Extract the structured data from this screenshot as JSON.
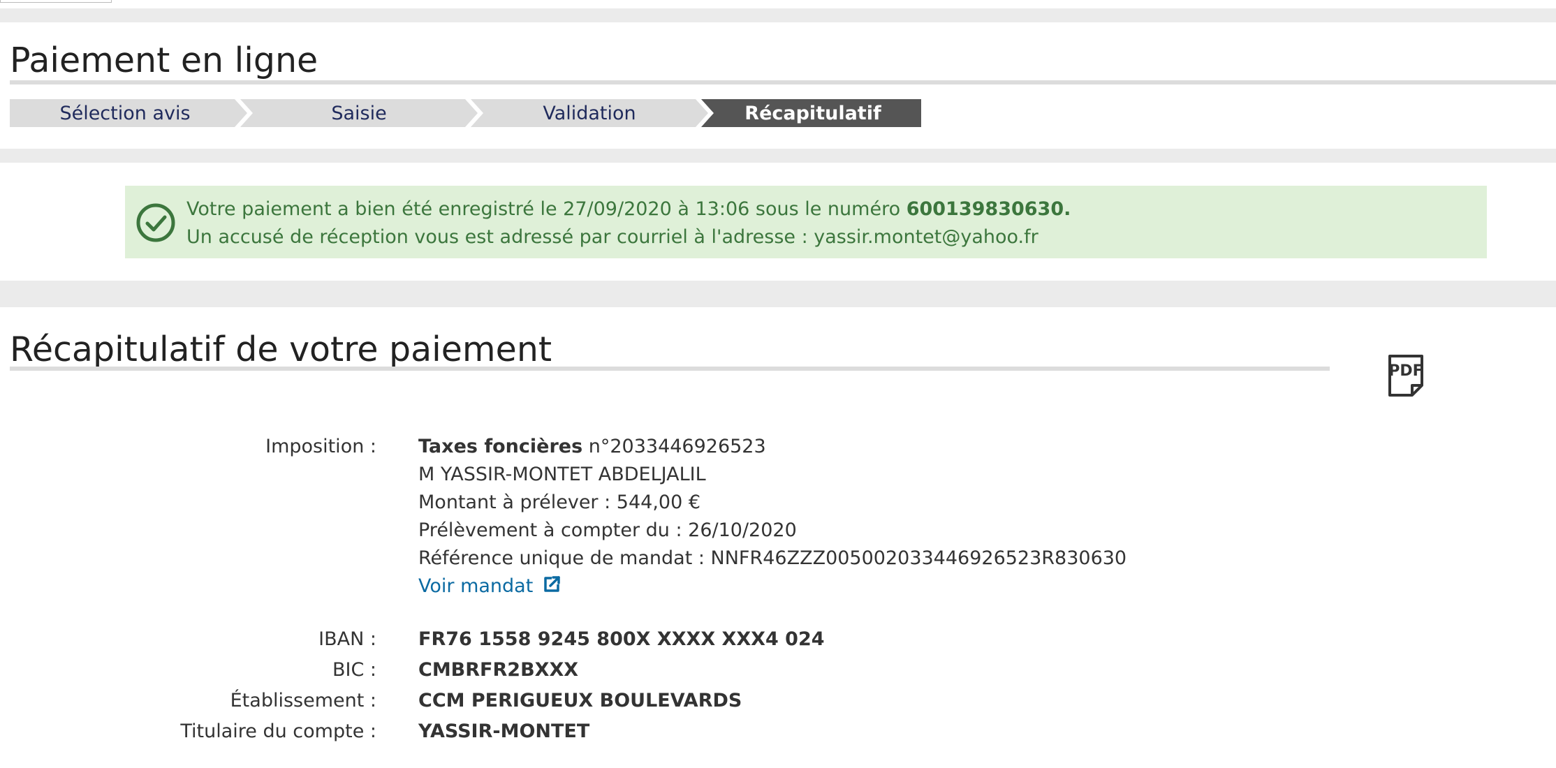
{
  "page": {
    "title": "Paiement en ligne",
    "steps": [
      "Sélection avis",
      "Saisie",
      "Validation",
      "Récapitulatif"
    ],
    "active_step": 3
  },
  "alert": {
    "line1_prefix": "Votre paiement a bien été enregistré le 27/09/2020 à 13:06 sous le numéro ",
    "payment_number": "600139830630.",
    "line2": "Un accusé de réception vous est adressé par courriel à l'adresse : yassir.montet@yahoo.fr",
    "icon": "check-circle-icon",
    "color": "#3c763d",
    "background": "#dff0d8"
  },
  "summary": {
    "title": "Récapitulatif de votre paiement",
    "pdf_icon": "pdf-icon",
    "imposition_label": "Imposition :",
    "tax_type": "Taxes foncières",
    "tax_number": " n°2033446926523",
    "holder_name": "M YASSIR-MONTET ABDELJALIL",
    "amount": "Montant à prélever : 544,00 €",
    "start_date": "Prélèvement à compter du : 26/10/2020",
    "mandate_ref": "Référence unique de mandat : NNFR46ZZZ005002033446926523R830630",
    "mandate_link": "Voir mandat",
    "external_link_icon": "external-link-icon",
    "iban_label": "IBAN :",
    "iban": "FR76 1558 9245 800X XXXX XXX4 024",
    "bic_label": "BIC :",
    "bic": "CMBRFR2BXXX",
    "bank_label": "Établissement :",
    "bank": "CCM PERIGUEUX BOULEVARDS",
    "account_holder_label": "Titulaire du compte :",
    "account_holder": "YASSIR-MONTET"
  },
  "colors": {
    "step_inactive": "#dcdcdc",
    "step_active": "#555555",
    "step_text": "#1f2a5c",
    "link": "#0b6aa2"
  }
}
